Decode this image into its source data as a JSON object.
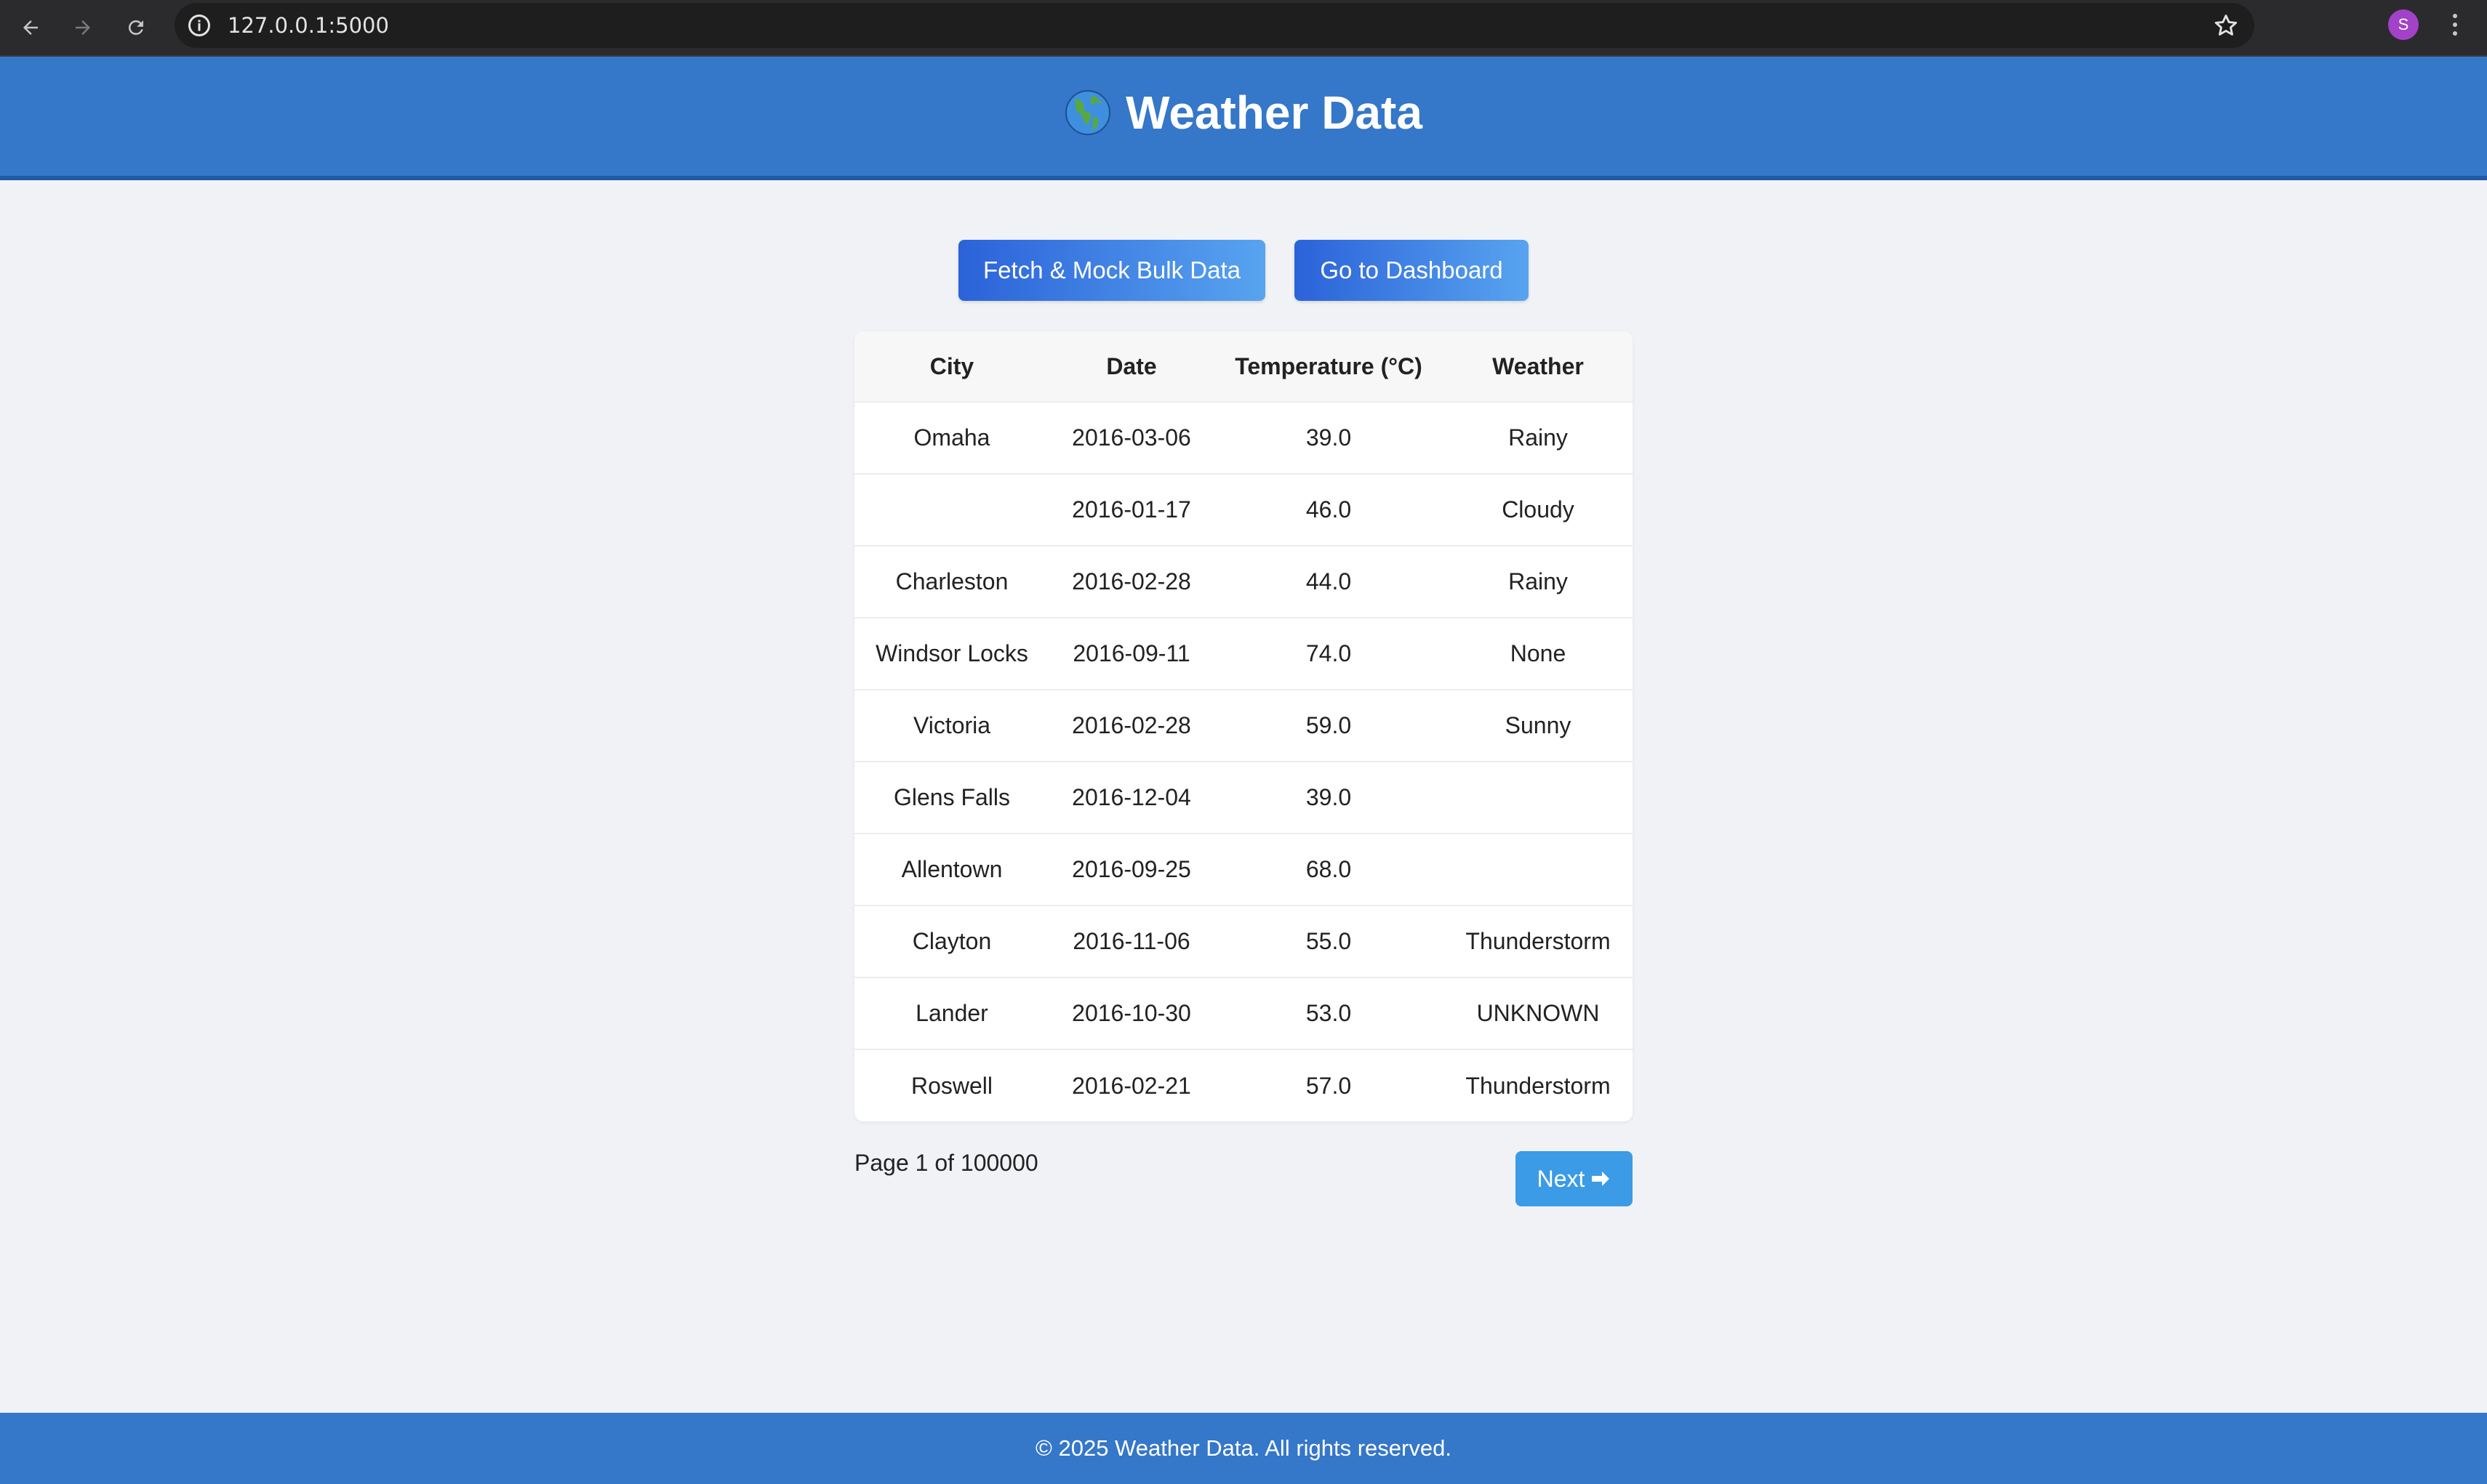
{
  "browser": {
    "url": "127.0.0.1:5000",
    "profile_initial": "S"
  },
  "header": {
    "title": "Weather Data",
    "icon": "globe-americas-icon"
  },
  "actions": {
    "fetch_label": "Fetch & Mock Bulk Data",
    "dashboard_label": "Go to Dashboard"
  },
  "table": {
    "columns": [
      "City",
      "Date",
      "Temperature (°C)",
      "Weather"
    ],
    "rows": [
      {
        "city": "Omaha",
        "date": "2016-03-06",
        "temp": "39.0",
        "weather": "Rainy"
      },
      {
        "city": "",
        "date": "2016-01-17",
        "temp": "46.0",
        "weather": "Cloudy"
      },
      {
        "city": "Charleston",
        "date": "2016-02-28",
        "temp": "44.0",
        "weather": "Rainy"
      },
      {
        "city": "Windsor Locks",
        "date": "2016-09-11",
        "temp": "74.0",
        "weather": "None"
      },
      {
        "city": "Victoria",
        "date": "2016-02-28",
        "temp": "59.0",
        "weather": "Sunny"
      },
      {
        "city": "Glens Falls",
        "date": "2016-12-04",
        "temp": "39.0",
        "weather": ""
      },
      {
        "city": "Allentown",
        "date": "2016-09-25",
        "temp": "68.0",
        "weather": ""
      },
      {
        "city": "Clayton",
        "date": "2016-11-06",
        "temp": "55.0",
        "weather": "Thunderstorm"
      },
      {
        "city": "Lander",
        "date": "2016-10-30",
        "temp": "53.0",
        "weather": "UNKNOWN"
      },
      {
        "city": "Roswell",
        "date": "2016-02-21",
        "temp": "57.0",
        "weather": "Thunderstorm"
      }
    ]
  },
  "pagination": {
    "info": "Page 1 of 100000",
    "next_label": "Next",
    "next_icon": "right-arrow-icon"
  },
  "footer": {
    "text": "© 2025 Weather Data. All rights reserved."
  },
  "colors": {
    "header_bg": "#3577c8",
    "page_bg": "#f0f2f5",
    "button_gradient_start": "#2b62d9",
    "button_gradient_end": "#58a4ef",
    "next_button": "#3b9be6"
  }
}
